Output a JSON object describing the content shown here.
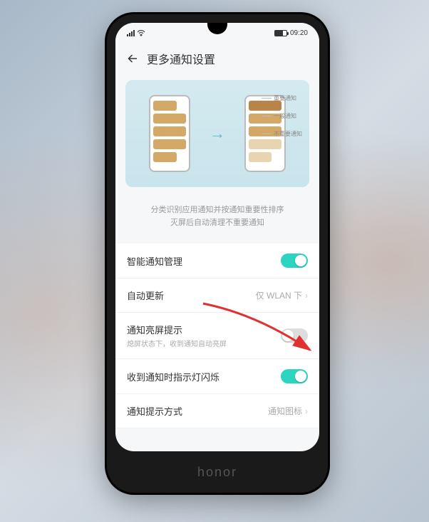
{
  "status": {
    "time": "09:20",
    "signal_icon": "signal",
    "wifi_icon": "wifi"
  },
  "header": {
    "title": "更多通知设置"
  },
  "illustration": {
    "labels": {
      "important": "重要通知",
      "general": "一般通知",
      "low": "不重要通知"
    }
  },
  "info": {
    "line1": "分类识别应用通知并按通知重要性排序",
    "line2": "灭屏后自动清理不重要通知"
  },
  "settings": {
    "smart_mgmt": {
      "label": "智能通知管理",
      "value": true
    },
    "auto_update": {
      "label": "自动更新",
      "value": "仅 WLAN 下"
    },
    "wake_screen": {
      "label": "通知亮屏提示",
      "sublabel": "熄屏状态下，收到通知自动亮屏",
      "value": false
    },
    "led_blink": {
      "label": "收到通知时指示灯闪烁",
      "value": true
    },
    "style": {
      "label": "通知提示方式",
      "value": "通知图标"
    }
  },
  "brand": "honor"
}
